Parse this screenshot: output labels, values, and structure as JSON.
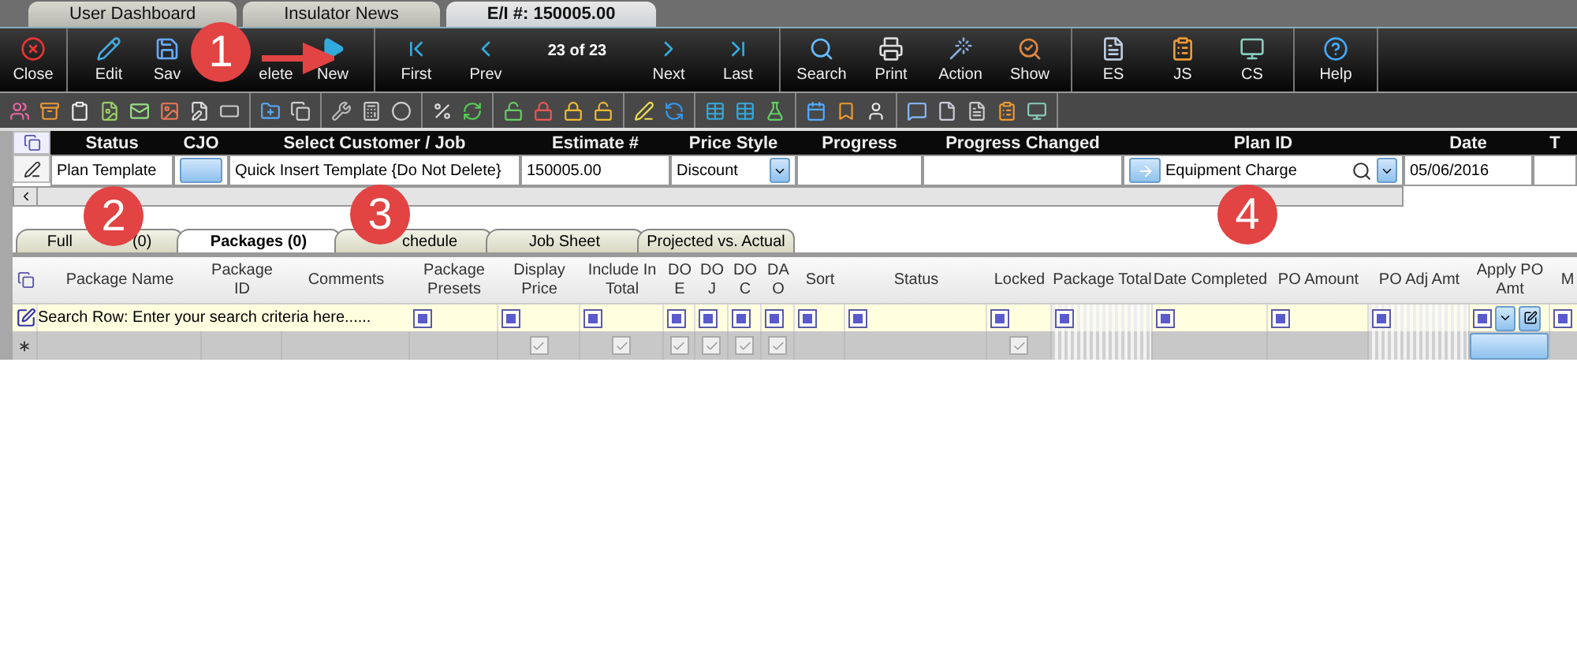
{
  "doc_tabs": [
    {
      "label": "User Dashboard",
      "selected": false
    },
    {
      "label": "Insulator News",
      "selected": false
    },
    {
      "label": "E/I #: 150005.00",
      "selected": true
    }
  ],
  "toolbar": {
    "groups": [
      [
        {
          "label": "Close",
          "kind": "close"
        }
      ],
      [
        {
          "label": "Edit",
          "kind": "edit"
        },
        {
          "label": "Sav",
          "kind": "save"
        },
        {
          "label": "elete",
          "kind": "delete"
        },
        {
          "label": "New",
          "kind": "new"
        }
      ],
      [
        {
          "label": "First",
          "kind": "first"
        },
        {
          "label": "Prev",
          "kind": "prev"
        },
        {
          "label": "23 of 23",
          "kind": "counter"
        },
        {
          "label": "Next",
          "kind": "next"
        },
        {
          "label": "Last",
          "kind": "last"
        }
      ],
      [
        {
          "label": "Search",
          "kind": "search"
        },
        {
          "label": "Print",
          "kind": "print"
        },
        {
          "label": "Action",
          "kind": "action"
        },
        {
          "label": "Show",
          "kind": "show"
        }
      ],
      [
        {
          "label": "ES",
          "kind": "es"
        },
        {
          "label": "JS",
          "kind": "js"
        },
        {
          "label": "CS",
          "kind": "cs"
        }
      ],
      [
        {
          "label": "Help",
          "kind": "help"
        }
      ]
    ]
  },
  "header_grid": {
    "columns": [
      {
        "header": "Status",
        "kind": "text",
        "value": "Plan Template"
      },
      {
        "header": "CJO",
        "kind": "button"
      },
      {
        "header": "Select Customer / Job",
        "kind": "text",
        "value": "Quick Insert Template {Do Not Delete}"
      },
      {
        "header": "Estimate #",
        "kind": "text",
        "value": "150005.00"
      },
      {
        "header": "Price Style",
        "kind": "dropdown",
        "value": "Discount"
      },
      {
        "header": "Progress",
        "kind": "text"
      },
      {
        "header": "Progress Changed",
        "kind": "text"
      },
      {
        "header": "Plan ID",
        "kind": "lookup",
        "value": "Equipment Charge"
      },
      {
        "header": "Date",
        "kind": "text",
        "value": "05/06/2016"
      },
      {
        "header": "T",
        "kind": "text"
      }
    ]
  },
  "section_tabs": [
    {
      "label": "Full",
      "count": "(0)",
      "selected": false
    },
    {
      "label": "Packages (0)",
      "selected": true
    },
    {
      "label": "chedule",
      "selected": false
    },
    {
      "label": "Job Sheet",
      "selected": false
    },
    {
      "label": "Projected vs. Actual",
      "selected": false
    }
  ],
  "packages_grid": {
    "search_row": "Search Row: Enter your search criteria here......",
    "columns": [
      {
        "header": "Package Name",
        "kind": "text"
      },
      {
        "header": "Package ID",
        "kind": "text"
      },
      {
        "header": "Comments",
        "kind": "text"
      },
      {
        "header": "Package Presets",
        "kind": "filter"
      },
      {
        "header": "Display Price",
        "kind": "check",
        "checked": true
      },
      {
        "header": "Include In Total",
        "kind": "check",
        "checked": true
      },
      {
        "header": "DO E",
        "kind": "check",
        "checked": true
      },
      {
        "header": "DO J",
        "kind": "check",
        "checked": true
      },
      {
        "header": "DO C",
        "kind": "check",
        "checked": true
      },
      {
        "header": "DA O",
        "kind": "check",
        "checked": true
      },
      {
        "header": "Sort",
        "kind": "filter"
      },
      {
        "header": "Status",
        "kind": "filter"
      },
      {
        "header": "Locked",
        "kind": "check",
        "checked": true
      },
      {
        "header": "Package Total",
        "kind": "readonly"
      },
      {
        "header": "Date Completed",
        "kind": "filter"
      },
      {
        "header": "PO Amount",
        "kind": "filter"
      },
      {
        "header": "PO Adj Amt",
        "kind": "readonly"
      },
      {
        "header": "Apply PO Amt",
        "kind": "button"
      },
      {
        "header": "M",
        "kind": "filter"
      }
    ]
  },
  "callouts": [
    {
      "number": "1",
      "arrow": true
    },
    {
      "number": "2",
      "arrow": false
    },
    {
      "number": "3",
      "arrow": false
    },
    {
      "number": "4",
      "arrow": false
    }
  ]
}
